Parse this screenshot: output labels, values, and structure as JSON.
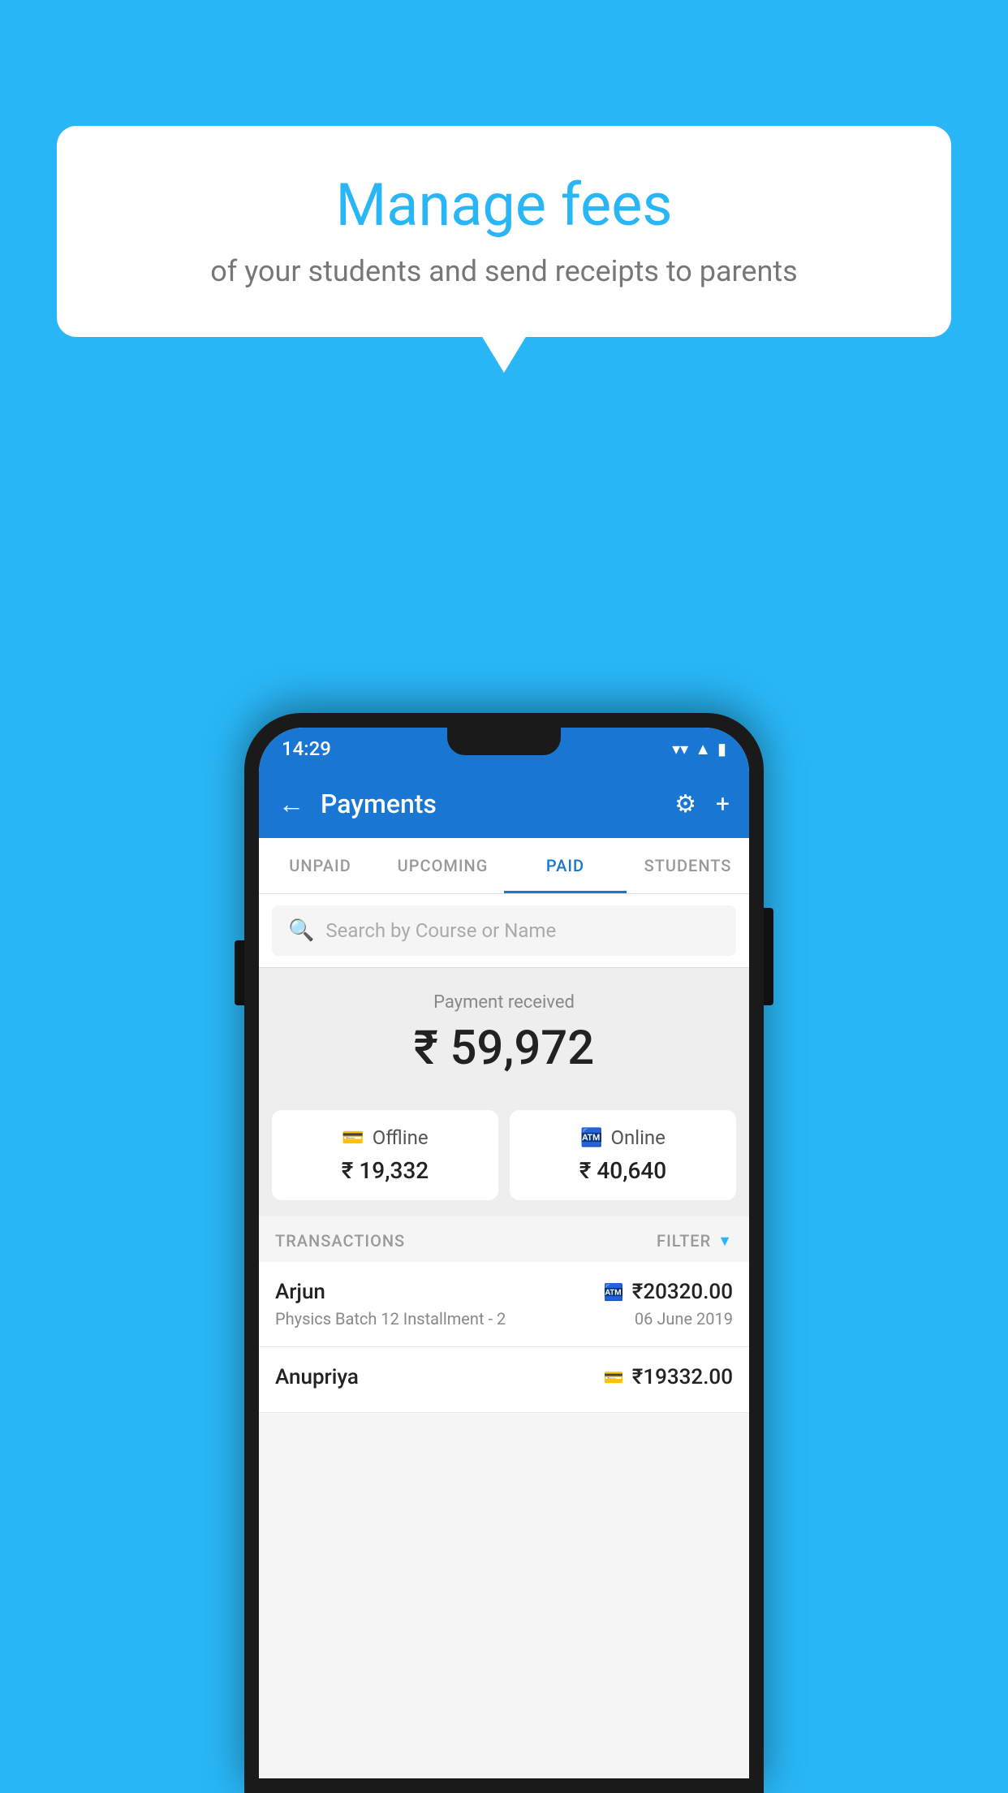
{
  "background_color": "#29B6F6",
  "speech_bubble": {
    "title": "Manage fees",
    "subtitle": "of your students and send receipts to parents"
  },
  "status_bar": {
    "time": "14:29",
    "wifi": "▼",
    "signal": "▲",
    "battery": "▮"
  },
  "app_bar": {
    "title": "Payments",
    "back_label": "←",
    "gear_label": "⚙",
    "plus_label": "+"
  },
  "tabs": [
    {
      "label": "UNPAID",
      "active": false
    },
    {
      "label": "UPCOMING",
      "active": false
    },
    {
      "label": "PAID",
      "active": true
    },
    {
      "label": "STUDENTS",
      "active": false
    }
  ],
  "search": {
    "placeholder": "Search by Course or Name"
  },
  "payment_summary": {
    "label": "Payment received",
    "amount": "₹ 59,972",
    "offline": {
      "type": "Offline",
      "amount": "₹ 19,332"
    },
    "online": {
      "type": "Online",
      "amount": "₹ 40,640"
    }
  },
  "transactions": {
    "label": "TRANSACTIONS",
    "filter_label": "FILTER",
    "rows": [
      {
        "name": "Arjun",
        "amount": "₹20320.00",
        "payment_mode": "online",
        "course": "Physics Batch 12 Installment - 2",
        "date": "06 June 2019"
      },
      {
        "name": "Anupriya",
        "amount": "₹19332.00",
        "payment_mode": "offline",
        "course": "",
        "date": ""
      }
    ]
  }
}
